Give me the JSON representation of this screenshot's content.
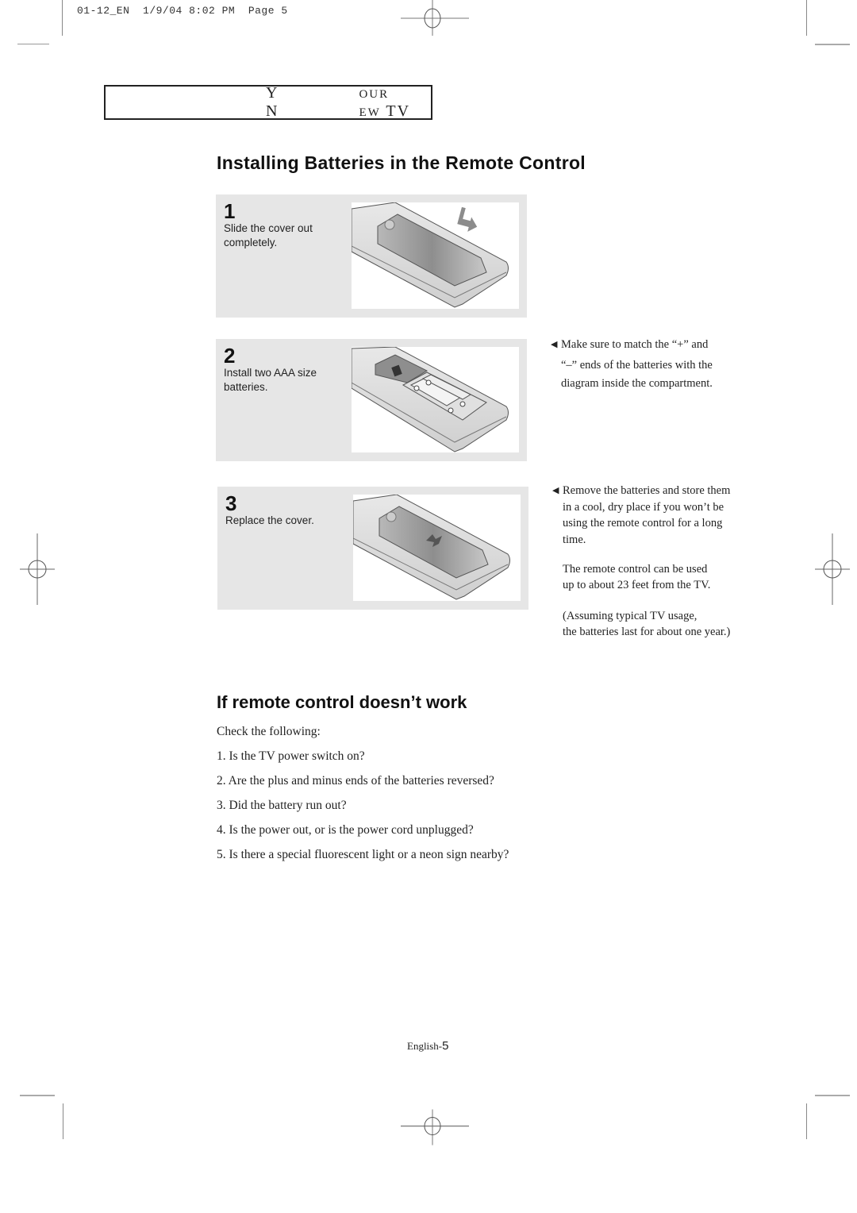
{
  "print_slug": "01-12_EN  1/9/04 8:02 PM  Page 5",
  "section_header": {
    "first_initial": "Y",
    "first_rest": "OUR",
    "second_initial": "N",
    "second_rest": "EW",
    "third": "TV"
  },
  "main_title": "Installing Batteries in the Remote Control",
  "steps": [
    {
      "number": "1",
      "description": "Slide the cover out completely.",
      "illustration": "remote-cover-slide-out"
    },
    {
      "number": "2",
      "description": "Install two AAA size batteries.",
      "illustration": "remote-batteries-installed"
    },
    {
      "number": "3",
      "description": "Replace the cover.",
      "illustration": "remote-cover-replace"
    }
  ],
  "notes": {
    "polarity": {
      "bullet_icon": "left-triangle",
      "lines": [
        "Make sure to match the “+” and",
        "“–” ends of the batteries with the",
        "diagram inside the compartment."
      ]
    },
    "storage": {
      "bullet_icon": "left-triangle",
      "lines": [
        "Remove the batteries and store them",
        "in a cool, dry place if you won’t be",
        "using the remote control for a long",
        "time."
      ]
    },
    "range": {
      "lines": [
        "The remote control can be used",
        "up to about 23 feet from the TV."
      ]
    },
    "battery_life": {
      "lines": [
        "(Assuming typical TV usage,",
        "the batteries last for about one year.)"
      ]
    }
  },
  "troubleshooting": {
    "title": "If remote control doesn’t work",
    "intro": "Check the following:",
    "items": [
      "1. Is the TV power switch on?",
      "2. Are the plus and minus ends of the batteries reversed?",
      "3. Did the battery run out?",
      "4. Is the power out, or is the power cord unplugged?",
      "5. Is there a special fluorescent light or a neon sign nearby?"
    ]
  },
  "footer": {
    "language": "English-",
    "page_number": "5"
  }
}
